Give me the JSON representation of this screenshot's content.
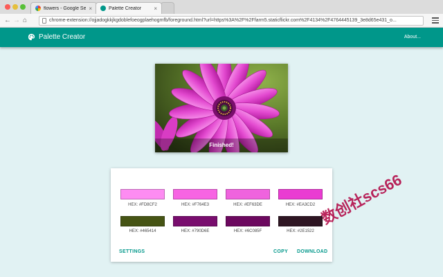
{
  "browser": {
    "tabs": [
      {
        "label": "flowers - Google Search",
        "icon": "google-icon",
        "active": false
      },
      {
        "label": "Palette Creator",
        "icon": "palette-icon",
        "active": true
      }
    ],
    "address": "chrome-extension://ojjadogkkjkgdoblefoeogplaehogmfb/foreground.html?url=https%3A%2F%2Ffarm5.staticflickr.com%2F4134%2F4764445139_3e8d65e431_o..."
  },
  "app": {
    "title": "Palette Creator",
    "about_label": "About...",
    "theme_color": "#00978a"
  },
  "image": {
    "status": "Finished!"
  },
  "palette": {
    "swatches": [
      {
        "hex": "#FD8CF2",
        "label": "HEX: #FD8CF2"
      },
      {
        "hex": "#F764E3",
        "label": "HEX: #F764E3"
      },
      {
        "hex": "#EF63DE",
        "label": "HEX: #EF63DE"
      },
      {
        "hex": "#EA3CD2",
        "label": "HEX: #EA3CD2"
      },
      {
        "hex": "#465414",
        "label": "HEX: #465414"
      },
      {
        "hex": "#790D6E",
        "label": "HEX: #790D6E"
      },
      {
        "hex": "#6C085F",
        "label": "HEX: #6C085F"
      },
      {
        "hex": "#2E1522",
        "label": "HEX: #2E1522"
      }
    ],
    "settings_label": "SETTINGS",
    "copy_label": "COPY",
    "download_label": "DOWNLOAD"
  },
  "watermark": "数创社scs66"
}
